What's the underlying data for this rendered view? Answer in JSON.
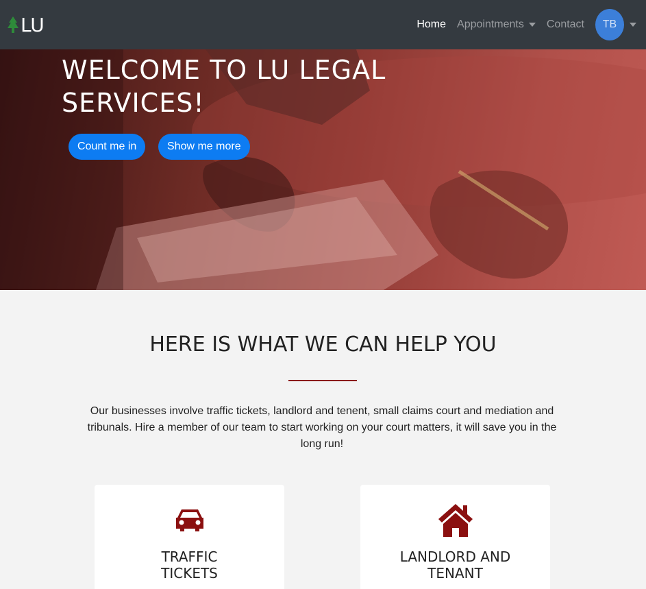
{
  "brand": {
    "text": "LU",
    "icon": "pine-tree-icon",
    "icon_color": "#2e8b3a"
  },
  "nav": {
    "home": "Home",
    "appointments": "Appointments",
    "contact": "Contact",
    "avatar_initials": "TB",
    "avatar_color": "#3c7fd9"
  },
  "hero": {
    "title": "WELCOME TO LU LEGAL SERVICES!",
    "primary_button": "Count me in",
    "secondary_button": "Show me more",
    "button_color": "#0d7cf2"
  },
  "services": {
    "title": "HERE IS WHAT WE CAN HELP YOU",
    "description": "Our businesses involve traffic tickets, landlord and tenent, small claims court and mediation and tribunals. Hire a member of our team to start working on your court matters, it will save you in the long run!",
    "accent_color": "#8b1a1a",
    "cards": [
      {
        "title": "TRAFFIC TICKETS",
        "icon": "car-icon"
      },
      {
        "title": "LANDLORD AND TENANT",
        "icon": "house-icon"
      }
    ]
  }
}
